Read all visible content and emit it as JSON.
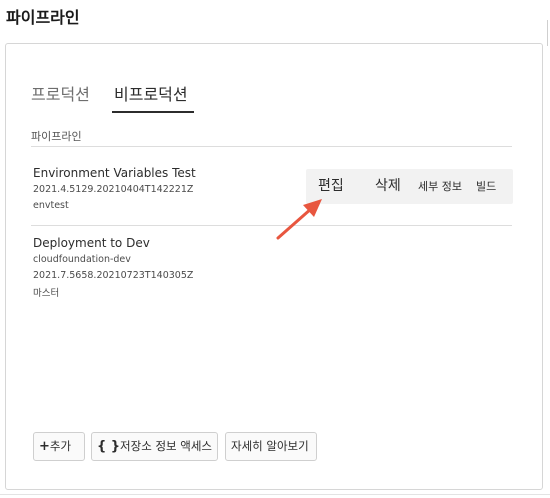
{
  "page": {
    "title": "파이프라인"
  },
  "tabs": [
    {
      "label": "프로덕션",
      "active": false
    },
    {
      "label": "비프로덕션",
      "active": true
    }
  ],
  "section": {
    "header": "파이프라인"
  },
  "pipelines": [
    {
      "name": "Environment Variables Test",
      "version": "2021.4.5129.20210404T142221Z",
      "branch": "envtest"
    },
    {
      "name": "Deployment to Dev",
      "repo": "cloudfoundation-dev",
      "version": "2021.7.5658.20210723T140305Z",
      "branch": "마스터"
    }
  ],
  "row_actions": {
    "edit": "편집",
    "delete": "삭제",
    "details": "세부 정보",
    "build": "빌드"
  },
  "footer_buttons": {
    "add": "추가",
    "add_icon": "+",
    "repo_access": "저장소 정보 액세스",
    "repo_icon": "{ }",
    "learn_more": "자세히 알아보기"
  },
  "colors": {
    "arrow": "#e8563f",
    "action_bar_bg": "#f2f2f2",
    "tab_active_underline": "#2c2c2c"
  }
}
